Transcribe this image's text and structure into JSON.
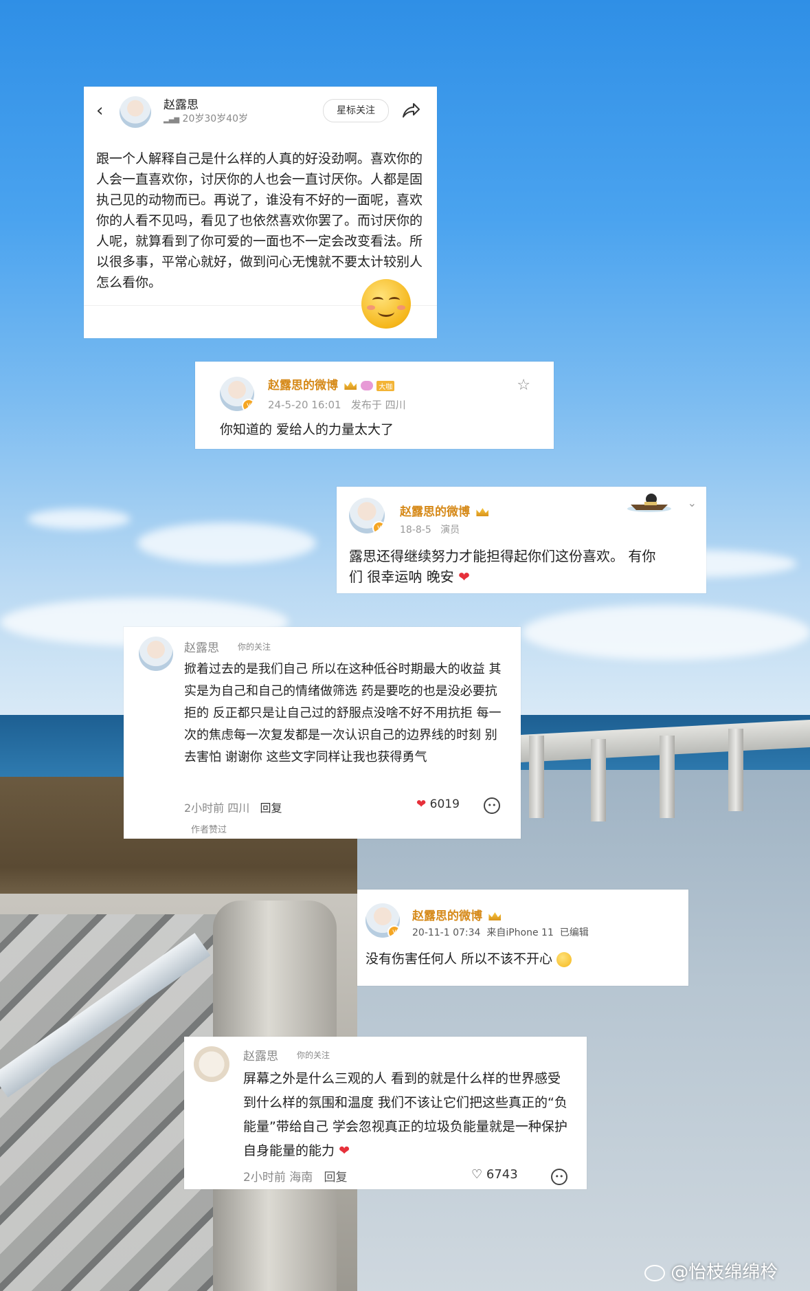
{
  "card1": {
    "name": "赵露思",
    "tags": "20岁30岁40岁",
    "follow_button": "星标关注",
    "body": "跟一个人解释自己是什么样的人真的好没劲啊。喜欢你的人会一直喜欢你，讨厌你的人也会一直讨厌你。人都是固执己见的动物而已。再说了，谁没有不好的一面呢，喜欢你的人看不见吗，看见了也依然喜欢你罢了。而讨厌你的人呢，就算看到了你可爱的一面也不一定会改变看法。所以很多事，平常心就好，做到问心无愧就不要太计较别人怎么看你。"
  },
  "card2": {
    "name": "赵露思的微博",
    "badge": "大咖",
    "time": "24-5-20 16:01",
    "location": "发布于 四川",
    "body": "你知道的 爱给人的力量太大了"
  },
  "card3": {
    "name": "赵露思的微博",
    "time": "18-8-5",
    "role": "演员",
    "body_line1": "露思还得继续努力才能担得起你们这份喜欢。 有你",
    "body_line2": "们 很幸运呐 晚安"
  },
  "card4": {
    "name": "赵露思",
    "tag": "你的关注",
    "body": "掀着过去的是我们自己 所以在这种低谷时期最大的收益 其实是为自己和自己的情绪做筛选 药是要吃的也是没必要抗拒的 反正都只是让自己过的舒服点没啥不好不用抗拒 每一次的焦虑每一次复发都是一次认识自己的边界线的时刻 别去害怕 谢谢你 这些文字同样让我也获得勇气",
    "meta": "2小时前 四川",
    "reply": "回复",
    "likes": "6019",
    "author_liked": "作者赞过"
  },
  "card5": {
    "name": "赵露思的微博",
    "time": "20-11-1 07:34",
    "source": "来自iPhone 11",
    "edited": "已编辑",
    "body": "没有伤害任何人 所以不该不开心"
  },
  "card6": {
    "name": "赵露思",
    "tag": "你的关注",
    "body": "屏幕之外是什么三观的人 看到的就是什么样的世界感受到什么样的氛围和温度 我们不该让它们把这些真正的“负能量”带给自己 学会忽视真正的垃圾负能量就是一种保护自身能量的能力",
    "meta": "2小时前 海南",
    "reply": "回复",
    "likes": "6743"
  },
  "watermark": "@怡枝绵绵柃",
  "colors": {
    "gold_name": "#d68a1a",
    "heart": "#e6303a",
    "sky": "#4aa3ef"
  }
}
